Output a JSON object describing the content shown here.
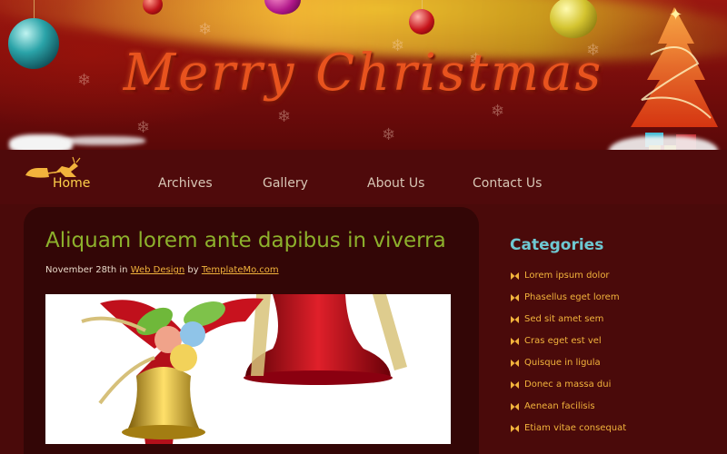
{
  "header": {
    "title": "Merry Christmas"
  },
  "nav": {
    "items": [
      {
        "label": "Home",
        "active": true
      },
      {
        "label": "Archives",
        "active": false
      },
      {
        "label": "Gallery",
        "active": false
      },
      {
        "label": "About Us",
        "active": false
      },
      {
        "label": "Contact Us",
        "active": false
      }
    ]
  },
  "post": {
    "title": "Aliquam lorem ante dapibus in viverra",
    "date": "November 28th",
    "in_text": "in",
    "category": "Web Design",
    "by_text": "by",
    "author": "TemplateMo.com",
    "image_icon": "christmas-bells-image"
  },
  "sidebar": {
    "title": "Categories",
    "bullet_icon": "bow-bullet-icon",
    "items": [
      "Lorem ipsum dolor",
      "Phasellus eget lorem",
      "Sed sit amet sem",
      "Cras eget est vel",
      "Quisque in ligula",
      "Donec a massa dui",
      "Aenean facilisis",
      "Etiam vitae consequat"
    ]
  },
  "colors": {
    "title_red": "#e8531e",
    "post_title_green": "#8db12c",
    "link_gold": "#f2b33c",
    "nav_active": "#ffd24a",
    "category_title": "#6ec8d2"
  }
}
